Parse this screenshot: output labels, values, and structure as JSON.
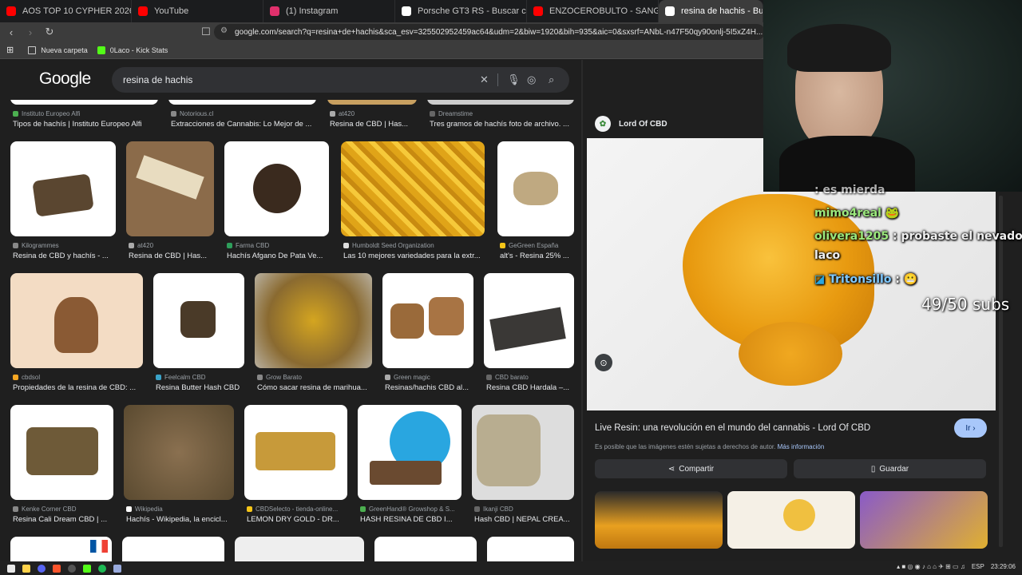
{
  "browser": {
    "tabs": [
      {
        "label": "AOS TOP 10 CYPHER 2026 ARG - You",
        "favicon": "youtube-icon",
        "color": "#ff0000"
      },
      {
        "label": "YouTube",
        "favicon": "youtube-icon",
        "color": "#ff0000"
      },
      {
        "label": "(1) Instagram",
        "favicon": "instagram-icon",
        "color": "#e1306c"
      },
      {
        "label": "Porsche GT3 RS - Buscar con Google",
        "favicon": "google-icon",
        "color": "#ffffff"
      },
      {
        "label": "ENZOCEROBULTO - SANGRE PURA D",
        "favicon": "youtube-icon",
        "color": "#ff0000"
      },
      {
        "label": "resina de hachis - Buscar con G",
        "favicon": "google-icon",
        "color": "#ffffff",
        "active": true
      }
    ],
    "url": "google.com/search?q=resina+de+hachis&sca_esv=325502952459ac64&udm=2&biw=1920&bih=935&aic=0&sxsrf=ANbL-n47F50qy90onlj-5I5xZ4H...",
    "bookmarks": [
      {
        "label": "Nueva carpeta",
        "icon": "folder-icon"
      },
      {
        "label": "0Laco - Kick Stats",
        "icon": "kick-icon"
      }
    ]
  },
  "google": {
    "logo": "Google",
    "query": "resina de hachis"
  },
  "results": {
    "row0": [
      {
        "source": "Instituto Europeo Alfi",
        "title": "Tipos de hachís | Instituto Europeo Alfi"
      },
      {
        "source": "Notorious.cl",
        "title": "Extracciones de Cannabis: Lo Mejor de ..."
      },
      {
        "source": "at420",
        "title": "Resina de CBD | Has..."
      },
      {
        "source": "Dreamstime",
        "title": "Tres gramos de hachís foto de archivo. ..."
      }
    ],
    "row1": [
      {
        "source": "Kilogrammes",
        "title": "Resina de CBD y hachís - ..."
      },
      {
        "source": "at420",
        "title": "Resina de CBD | Has..."
      },
      {
        "source": "Farma CBD",
        "title": "Hachís Afgano De Pata Ve..."
      },
      {
        "source": "Humboldt Seed Organization",
        "title": "Las 10 mejores variedades para la extr..."
      },
      {
        "source": "GeGreen España",
        "title": "alt's - Resina 25% ..."
      }
    ],
    "row2": [
      {
        "source": "cbdsol",
        "title": "Propiedades de la resina de CBD: ..."
      },
      {
        "source": "Feelcalm CBD",
        "title": "Resina Butter Hash CBD"
      },
      {
        "source": "Grow Barato",
        "title": "Cómo sacar resina de marihua..."
      },
      {
        "source": "Green magic",
        "title": "Resinas/hachis CBD al..."
      },
      {
        "source": "CBD barato",
        "title": "Resina CBD Hardala –..."
      }
    ],
    "row3": [
      {
        "source": "Kenke Corner CBD",
        "title": "Resina Cali Dream CBD | ..."
      },
      {
        "source": "Wikipedia",
        "title": "Hachís - Wikipedia, la encicl..."
      },
      {
        "source": "CBDSelecto - tienda-online...",
        "title": "LEMON DRY GOLD - DR..."
      },
      {
        "source": "GreenHand® Growshop & S...",
        "title": "HASH RESINA DE CBD I..."
      },
      {
        "source": "Ikanji CBD",
        "title": "Hash CBD | NEPAL CREA..."
      }
    ]
  },
  "panel": {
    "source": "Lord Of CBD",
    "title": "Live Resin: una revolución en el mundo del cannabis - Lord Of CBD",
    "go_label": "Ir",
    "note": "Es posible que las imágenes estén sujetas a derechos de autor.",
    "note_link": "Más información",
    "share_label": "Compartir",
    "save_label": "Guardar"
  },
  "overlay": {
    "chat_partial": ": es mierda",
    "chat": [
      {
        "user": "mimo4real",
        "msg": ""
      },
      {
        "user": "olivera1205",
        "msg": ": probaste el nevado"
      },
      {
        "user": "",
        "msg": "laco"
      },
      {
        "user": "Tritonsillo",
        "msg": ":"
      }
    ],
    "subs": "49/50 subs"
  },
  "taskbar": {
    "lang": "ESP",
    "time": "23:29:06"
  }
}
